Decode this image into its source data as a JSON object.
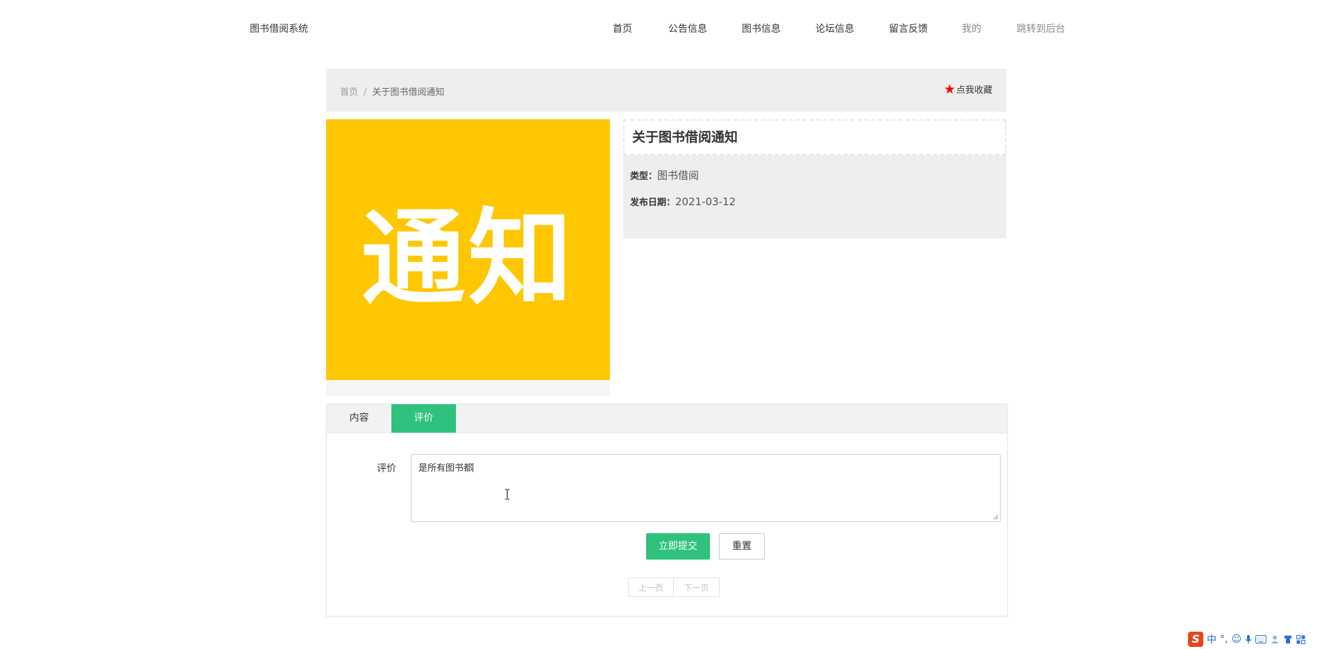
{
  "site": {
    "title": "图书借阅系统"
  },
  "nav": {
    "items": [
      {
        "label": "首页"
      },
      {
        "label": "公告信息"
      },
      {
        "label": "图书信息"
      },
      {
        "label": "论坛信息"
      },
      {
        "label": "留言反馈"
      },
      {
        "label": "我的"
      },
      {
        "label": "跳转到后台"
      }
    ]
  },
  "breadcrumb": {
    "home": "首页",
    "separator": "/",
    "current": "关于图书借阅通知"
  },
  "favorite": {
    "label": "点我收藏",
    "icon": "star-icon",
    "icon_color": "#ff0000"
  },
  "notice_image": {
    "text": "通知",
    "background": "#fec701"
  },
  "info": {
    "title": "关于图书借阅通知",
    "type_label": "类型：",
    "type_value": "图书借阅",
    "date_label": "发布日期：",
    "date_value": "2021-03-12"
  },
  "tabs": [
    {
      "label": "内容",
      "active": false
    },
    {
      "label": "评价",
      "active": true
    }
  ],
  "review_form": {
    "label": "评价",
    "value": "是所有图书都",
    "submit_label": "立即提交",
    "reset_label": "重置"
  },
  "pager": {
    "prev_label": "上一页",
    "next_label": "下一页"
  },
  "ime_toolbar": {
    "mode_label": "中",
    "punct_label": "°,",
    "icons": [
      "sogou-logo-icon",
      "emoji-icon",
      "microphone-icon",
      "keyboard-icon",
      "user-icon",
      "shirt-icon",
      "grid-icon"
    ]
  },
  "colors": {
    "accent": "#2ec27e",
    "breadcrumb_bg": "#eeeeee",
    "notice_yellow": "#fec701"
  }
}
